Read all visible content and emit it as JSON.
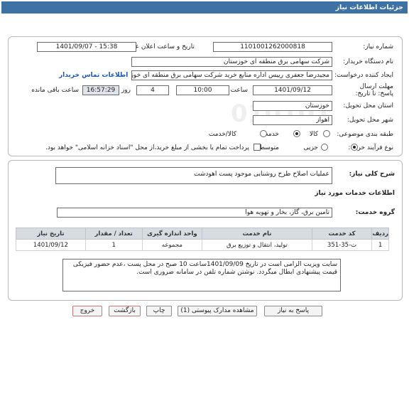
{
  "header": {
    "title": "جزئیات اطلاعات نیاز"
  },
  "form": {
    "need_number_label": "شماره نیاز:",
    "need_number": "1101001262000818",
    "announce_label": "تاریخ و ساعت اعلان عمومی:",
    "announce_value": "1401/09/07 - 15:38",
    "buyer_label": "نام دستگاه خریدار:",
    "buyer_value": "شرکت سهامی برق منطقه ای خوزستان",
    "creator_label": "ایجاد کننده درخواست:",
    "creator_value": "مجیدرضا جعفری رییس اداره منابع خرید شرکت سهامی برق منطقه ای خوزستان",
    "contact_link": "اطلاعات تماس خریدار",
    "deadline_label": "مهلت ارسال پاسخ: تا تاریخ:",
    "deadline_date": "1401/09/12",
    "time_label": "ساعت",
    "deadline_time": "10:00",
    "days_value": "4",
    "days_label": "روز و",
    "remaining_time": "16:57:29",
    "remaining_label": "ساعت باقی مانده",
    "province_label": "استان محل تحویل:",
    "province_value": "خوزستان",
    "city_label": "شهر محل تحویل:",
    "city_value": "اهواز",
    "category_label": "طبقه بندی موضوعی:",
    "category_options": [
      "کالا",
      "خدمت",
      "کالا/خدمت"
    ],
    "category_selected": "خدمت",
    "process_label": "نوع فرآیند خرید :",
    "process_options": [
      "جزیی",
      "متوسط"
    ],
    "process_selected": "جزیی",
    "payment_note": "پرداخت تمام یا بخشی از مبلغ خرید،از محل \"اسناد خزانه اسلامی\" خواهد بود."
  },
  "summary": {
    "label": "شرح کلی نیاز:",
    "value": "عملیات اصلاح طرح روشنایی موجود پست اهودشت"
  },
  "services": {
    "section_title": "اطلاعات خدمات مورد نیاز",
    "group_label": "گروه خدمت:",
    "group_value": "تامین برق، گاز، بخار و تهویه هوا",
    "table": {
      "headers": [
        "ردیف",
        "کد خدمت",
        "نام خدمت",
        "واحد اندازه گیری",
        "تعداد / مقدار",
        "تاریخ نیاز"
      ],
      "rows": [
        [
          "1",
          "ت-35-351",
          "تولید، انتقال و توزیع برق",
          "مجموعه",
          "1",
          "1401/09/12"
        ]
      ]
    },
    "note": "سایت ویزیت الزامی است در تاریخ 1401/09/09ساعت 10 صبح در محل پست ،عدم حضور فیزیکی قیمت پیشنهادی ابطال میگردد. نوشتن شماره تلفن در سامانه  ضروری است."
  },
  "buttons": {
    "reply": "پاسخ به نیاز",
    "docs": "مشاهده مدارک پیوستی (1)",
    "print": "چاپ",
    "back": "بازگشت",
    "exit": "خروج"
  },
  "watermark": {
    "brand": "ParsNamadData",
    "phone": "021-88349670",
    "code": "010101"
  }
}
